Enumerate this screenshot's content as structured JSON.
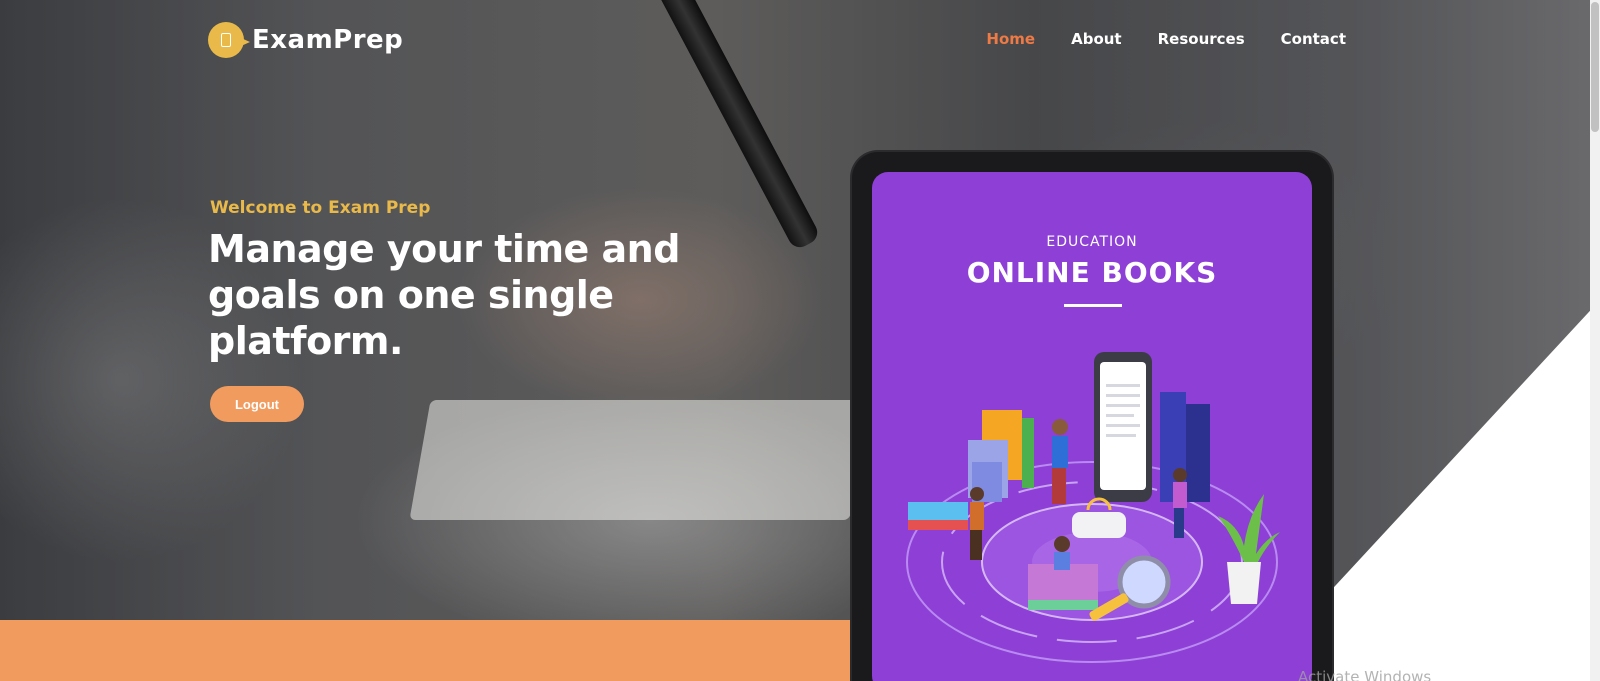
{
  "brand": {
    "name": "ExamPrep",
    "logo_icon": "book-chat-icon",
    "accent": "#e9b94a"
  },
  "nav": {
    "items": [
      {
        "label": "Home",
        "active": true
      },
      {
        "label": "About",
        "active": false
      },
      {
        "label": "Resources",
        "active": false
      },
      {
        "label": "Contact",
        "active": false
      }
    ],
    "active_color": "#ee7a45"
  },
  "hero": {
    "kicker": "Welcome to Exam Prep",
    "headline": "Manage your time and goals on one single platform.",
    "button_label": "Logout",
    "button_color": "#f19b5f"
  },
  "tablet": {
    "kicker": "EDUCATION",
    "title": "ONLINE BOOKS",
    "screen_color": "#8d3fd6"
  },
  "os": {
    "watermark": "Activate Windows"
  }
}
